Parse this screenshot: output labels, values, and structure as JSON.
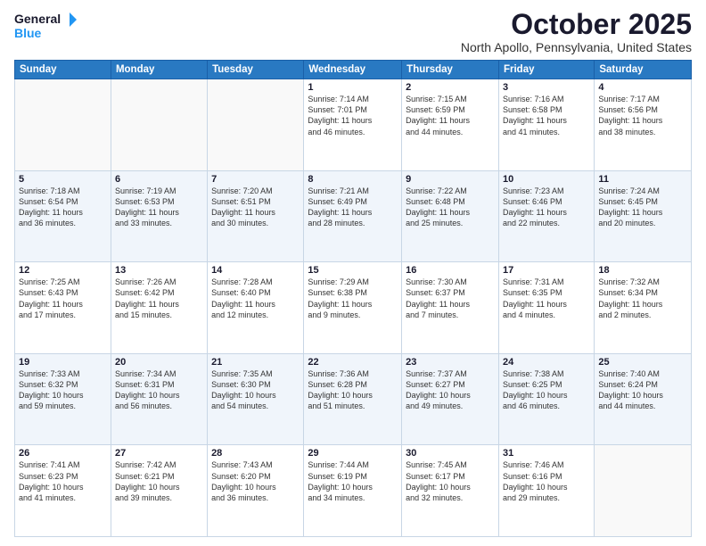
{
  "header": {
    "logo_line1": "General",
    "logo_line2": "Blue",
    "month": "October 2025",
    "location": "North Apollo, Pennsylvania, United States"
  },
  "weekdays": [
    "Sunday",
    "Monday",
    "Tuesday",
    "Wednesday",
    "Thursday",
    "Friday",
    "Saturday"
  ],
  "weeks": [
    [
      {
        "day": "",
        "info": ""
      },
      {
        "day": "",
        "info": ""
      },
      {
        "day": "",
        "info": ""
      },
      {
        "day": "1",
        "info": "Sunrise: 7:14 AM\nSunset: 7:01 PM\nDaylight: 11 hours\nand 46 minutes."
      },
      {
        "day": "2",
        "info": "Sunrise: 7:15 AM\nSunset: 6:59 PM\nDaylight: 11 hours\nand 44 minutes."
      },
      {
        "day": "3",
        "info": "Sunrise: 7:16 AM\nSunset: 6:58 PM\nDaylight: 11 hours\nand 41 minutes."
      },
      {
        "day": "4",
        "info": "Sunrise: 7:17 AM\nSunset: 6:56 PM\nDaylight: 11 hours\nand 38 minutes."
      }
    ],
    [
      {
        "day": "5",
        "info": "Sunrise: 7:18 AM\nSunset: 6:54 PM\nDaylight: 11 hours\nand 36 minutes."
      },
      {
        "day": "6",
        "info": "Sunrise: 7:19 AM\nSunset: 6:53 PM\nDaylight: 11 hours\nand 33 minutes."
      },
      {
        "day": "7",
        "info": "Sunrise: 7:20 AM\nSunset: 6:51 PM\nDaylight: 11 hours\nand 30 minutes."
      },
      {
        "day": "8",
        "info": "Sunrise: 7:21 AM\nSunset: 6:49 PM\nDaylight: 11 hours\nand 28 minutes."
      },
      {
        "day": "9",
        "info": "Sunrise: 7:22 AM\nSunset: 6:48 PM\nDaylight: 11 hours\nand 25 minutes."
      },
      {
        "day": "10",
        "info": "Sunrise: 7:23 AM\nSunset: 6:46 PM\nDaylight: 11 hours\nand 22 minutes."
      },
      {
        "day": "11",
        "info": "Sunrise: 7:24 AM\nSunset: 6:45 PM\nDaylight: 11 hours\nand 20 minutes."
      }
    ],
    [
      {
        "day": "12",
        "info": "Sunrise: 7:25 AM\nSunset: 6:43 PM\nDaylight: 11 hours\nand 17 minutes."
      },
      {
        "day": "13",
        "info": "Sunrise: 7:26 AM\nSunset: 6:42 PM\nDaylight: 11 hours\nand 15 minutes."
      },
      {
        "day": "14",
        "info": "Sunrise: 7:28 AM\nSunset: 6:40 PM\nDaylight: 11 hours\nand 12 minutes."
      },
      {
        "day": "15",
        "info": "Sunrise: 7:29 AM\nSunset: 6:38 PM\nDaylight: 11 hours\nand 9 minutes."
      },
      {
        "day": "16",
        "info": "Sunrise: 7:30 AM\nSunset: 6:37 PM\nDaylight: 11 hours\nand 7 minutes."
      },
      {
        "day": "17",
        "info": "Sunrise: 7:31 AM\nSunset: 6:35 PM\nDaylight: 11 hours\nand 4 minutes."
      },
      {
        "day": "18",
        "info": "Sunrise: 7:32 AM\nSunset: 6:34 PM\nDaylight: 11 hours\nand 2 minutes."
      }
    ],
    [
      {
        "day": "19",
        "info": "Sunrise: 7:33 AM\nSunset: 6:32 PM\nDaylight: 10 hours\nand 59 minutes."
      },
      {
        "day": "20",
        "info": "Sunrise: 7:34 AM\nSunset: 6:31 PM\nDaylight: 10 hours\nand 56 minutes."
      },
      {
        "day": "21",
        "info": "Sunrise: 7:35 AM\nSunset: 6:30 PM\nDaylight: 10 hours\nand 54 minutes."
      },
      {
        "day": "22",
        "info": "Sunrise: 7:36 AM\nSunset: 6:28 PM\nDaylight: 10 hours\nand 51 minutes."
      },
      {
        "day": "23",
        "info": "Sunrise: 7:37 AM\nSunset: 6:27 PM\nDaylight: 10 hours\nand 49 minutes."
      },
      {
        "day": "24",
        "info": "Sunrise: 7:38 AM\nSunset: 6:25 PM\nDaylight: 10 hours\nand 46 minutes."
      },
      {
        "day": "25",
        "info": "Sunrise: 7:40 AM\nSunset: 6:24 PM\nDaylight: 10 hours\nand 44 minutes."
      }
    ],
    [
      {
        "day": "26",
        "info": "Sunrise: 7:41 AM\nSunset: 6:23 PM\nDaylight: 10 hours\nand 41 minutes."
      },
      {
        "day": "27",
        "info": "Sunrise: 7:42 AM\nSunset: 6:21 PM\nDaylight: 10 hours\nand 39 minutes."
      },
      {
        "day": "28",
        "info": "Sunrise: 7:43 AM\nSunset: 6:20 PM\nDaylight: 10 hours\nand 36 minutes."
      },
      {
        "day": "29",
        "info": "Sunrise: 7:44 AM\nSunset: 6:19 PM\nDaylight: 10 hours\nand 34 minutes."
      },
      {
        "day": "30",
        "info": "Sunrise: 7:45 AM\nSunset: 6:17 PM\nDaylight: 10 hours\nand 32 minutes."
      },
      {
        "day": "31",
        "info": "Sunrise: 7:46 AM\nSunset: 6:16 PM\nDaylight: 10 hours\nand 29 minutes."
      },
      {
        "day": "",
        "info": ""
      }
    ]
  ]
}
